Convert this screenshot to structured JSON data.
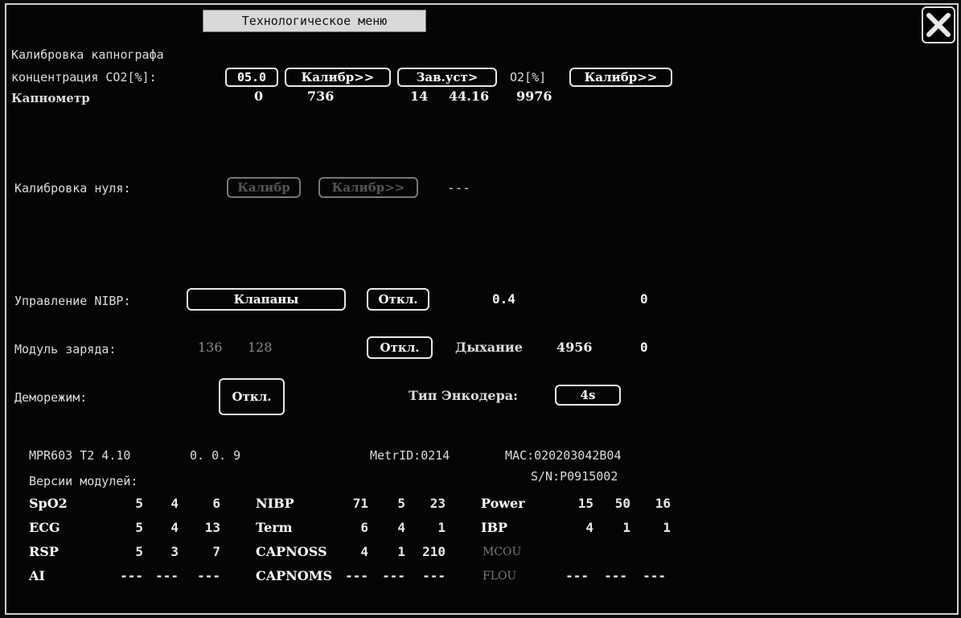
{
  "window": {
    "title": "Технологическое меню"
  },
  "capno": {
    "section_label": "Калибровка капнографа",
    "conc_label": "концентрация CO2[%]:",
    "conc_value": "05.0",
    "calib_button": "Калибр>>",
    "defaults_button": "Зав.уст>",
    "o2_label": "O2[%]",
    "o2_calib_button": "Калибр>>",
    "meter_label": "Капнометр",
    "meter_values": [
      "0",
      "736",
      "14",
      "44.16",
      "9976"
    ]
  },
  "zero": {
    "label": "Калибровка нуля:",
    "button1": "Калибр",
    "button2": "Калибр>>",
    "status": "---"
  },
  "nibp": {
    "label": "Управление NIBP:",
    "valves_button": "Клапаны",
    "off_button": "Откл.",
    "value1": "0.4",
    "value2": "0"
  },
  "charge": {
    "label": "Модуль заряда:",
    "value1": "136",
    "value2": "128",
    "off_button": "Откл.",
    "breath_label": "Дыхание",
    "breath_value": "4956",
    "breath_value2": "0"
  },
  "demo": {
    "label": "Деморежим:",
    "off_button": "Откл.",
    "encoder_label": "Тип Энкодера:",
    "encoder_value": "4s"
  },
  "info": {
    "firmware": "MPR603 T2 4.10",
    "version": "0. 0. 9",
    "metr_id": "MetrID:0214",
    "mac": "MAC:020203042B04",
    "serial": "S/N:P0915002",
    "modules_label": "Версии модулей:"
  },
  "modules": {
    "col1": [
      {
        "name": "SpO2",
        "v": [
          "5",
          "4",
          "6"
        ]
      },
      {
        "name": "ECG",
        "v": [
          "5",
          "4",
          "13"
        ]
      },
      {
        "name": "RSP",
        "v": [
          "5",
          "3",
          "7"
        ]
      },
      {
        "name": "AI",
        "v": [
          "---",
          "---",
          "---"
        ]
      }
    ],
    "col2": [
      {
        "name": "NIBP",
        "v": [
          "71",
          "5",
          "23"
        ]
      },
      {
        "name": "Term",
        "v": [
          "6",
          "4",
          "1"
        ]
      },
      {
        "name": "CAPNOSS",
        "v": [
          "4",
          "1",
          "210"
        ]
      },
      {
        "name": "CAPNOMS",
        "v": [
          "---",
          "---",
          "---"
        ]
      }
    ],
    "col3": [
      {
        "name": "Power",
        "v": [
          "15",
          "50",
          "16"
        ]
      },
      {
        "name": "IBP",
        "v": [
          "4",
          "1",
          "1"
        ]
      },
      {
        "name": "MCOU",
        "v": [
          "",
          "",
          ""
        ]
      },
      {
        "name": "FLOU",
        "v": [
          "---",
          "---",
          "---"
        ]
      }
    ]
  },
  "colors": {
    "background": "#050505",
    "text": "#d8d8d8",
    "disabled": "#777777"
  }
}
